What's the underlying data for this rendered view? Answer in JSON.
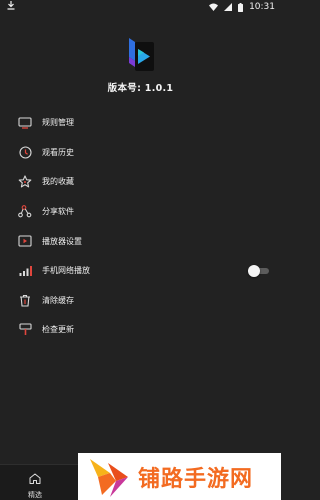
{
  "status_bar": {
    "time": "10:31"
  },
  "app": {
    "version_text": "版本号: 1.0.1"
  },
  "menu": [
    {
      "label": "规则管理",
      "icon": "monitor-icon"
    },
    {
      "label": "观看历史",
      "icon": "clock-icon"
    },
    {
      "label": "我的收藏",
      "icon": "star-icon"
    },
    {
      "label": "分享软件",
      "icon": "share-icon"
    },
    {
      "label": "播放器设置",
      "icon": "player-icon"
    },
    {
      "label": "手机网络播放",
      "icon": "signal-icon",
      "toggle_on": false
    },
    {
      "label": "清除缓存",
      "icon": "trash-icon"
    },
    {
      "label": "检查更新",
      "icon": "hammer-icon"
    }
  ],
  "bottom_nav": {
    "home_label": "精选"
  },
  "watermark": {
    "text": "铺路手游网"
  },
  "colors": {
    "accent_red": "#e0463d",
    "background": "#222222"
  }
}
